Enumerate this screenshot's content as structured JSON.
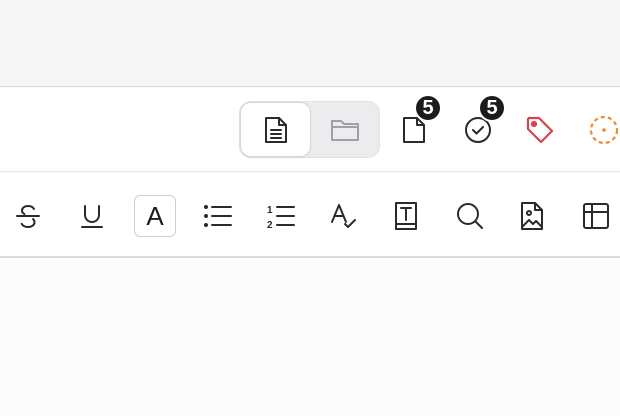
{
  "header": {
    "view_switch": {
      "options": [
        {
          "icon": "document-icon",
          "active": true
        },
        {
          "icon": "folder-icon",
          "active": false
        }
      ]
    },
    "pages_badge": "5",
    "tasks_badge": "5",
    "colors": {
      "tag": "#d9434e",
      "status": "#ef8a2e",
      "badge_bg": "#1c1c1e"
    }
  },
  "toolbar": {
    "items": [
      {
        "icon": "strikethrough-icon"
      },
      {
        "icon": "underline-icon"
      },
      {
        "icon": "font-color-icon",
        "label": "A",
        "selected": true
      },
      {
        "icon": "bullet-list-icon"
      },
      {
        "icon": "numbered-list-icon"
      },
      {
        "icon": "spellcheck-icon"
      },
      {
        "icon": "text-block-icon"
      },
      {
        "icon": "search-icon"
      },
      {
        "icon": "image-file-icon"
      },
      {
        "icon": "table-icon"
      }
    ]
  }
}
